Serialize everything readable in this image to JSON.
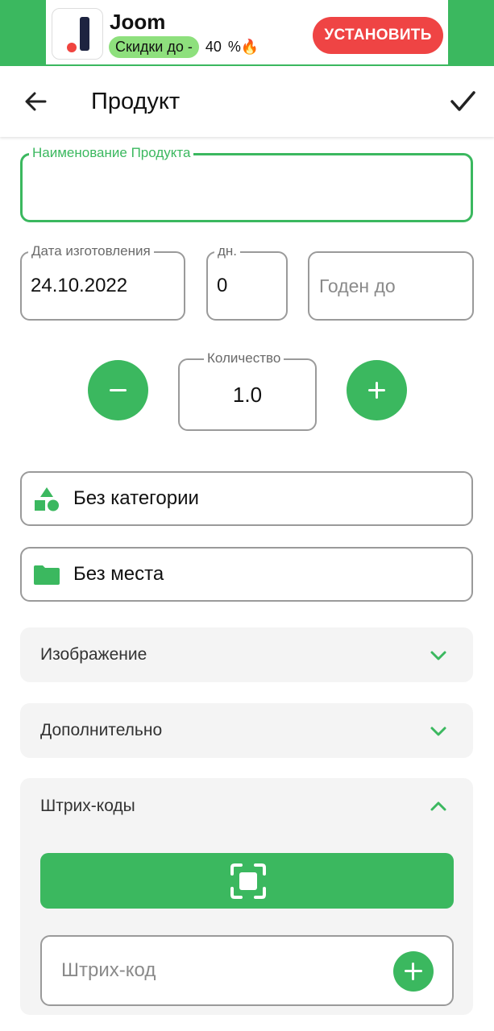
{
  "ad": {
    "title": "Joom",
    "promo_text": "Скидки до -",
    "promo_value": "40",
    "promo_suffix": "%🔥",
    "install_label": "УСТАНОВИТЬ",
    "logo_icon": "joom-logo"
  },
  "app_bar": {
    "title": "Продукт",
    "back_icon": "arrow-left-icon",
    "save_icon": "check-icon"
  },
  "form": {
    "name": {
      "label": "Наименование Продукта",
      "value": ""
    },
    "manufacture_date": {
      "label": "Дата изготовления",
      "value": "24.10.2022"
    },
    "days": {
      "label": "дн.",
      "value": "0"
    },
    "expires": {
      "placeholder": "Годен до"
    },
    "quantity": {
      "label": "Количество",
      "value": "1.0"
    }
  },
  "selectors": {
    "category": {
      "label": "Без категории",
      "icon": "shapes-icon"
    },
    "place": {
      "label": "Без места",
      "icon": "folder-icon"
    }
  },
  "sections": {
    "image": {
      "title": "Изображение",
      "expanded": false
    },
    "extra": {
      "title": "Дополнительно",
      "expanded": false
    },
    "barcodes": {
      "title": "Штрих-коды",
      "expanded": true,
      "input_placeholder": "Штрих-код"
    }
  },
  "colors": {
    "accent": "#3bb85f",
    "ad_button": "#ef4444",
    "section_bg": "#f4f4f4",
    "outline": "#9a9a9a"
  }
}
